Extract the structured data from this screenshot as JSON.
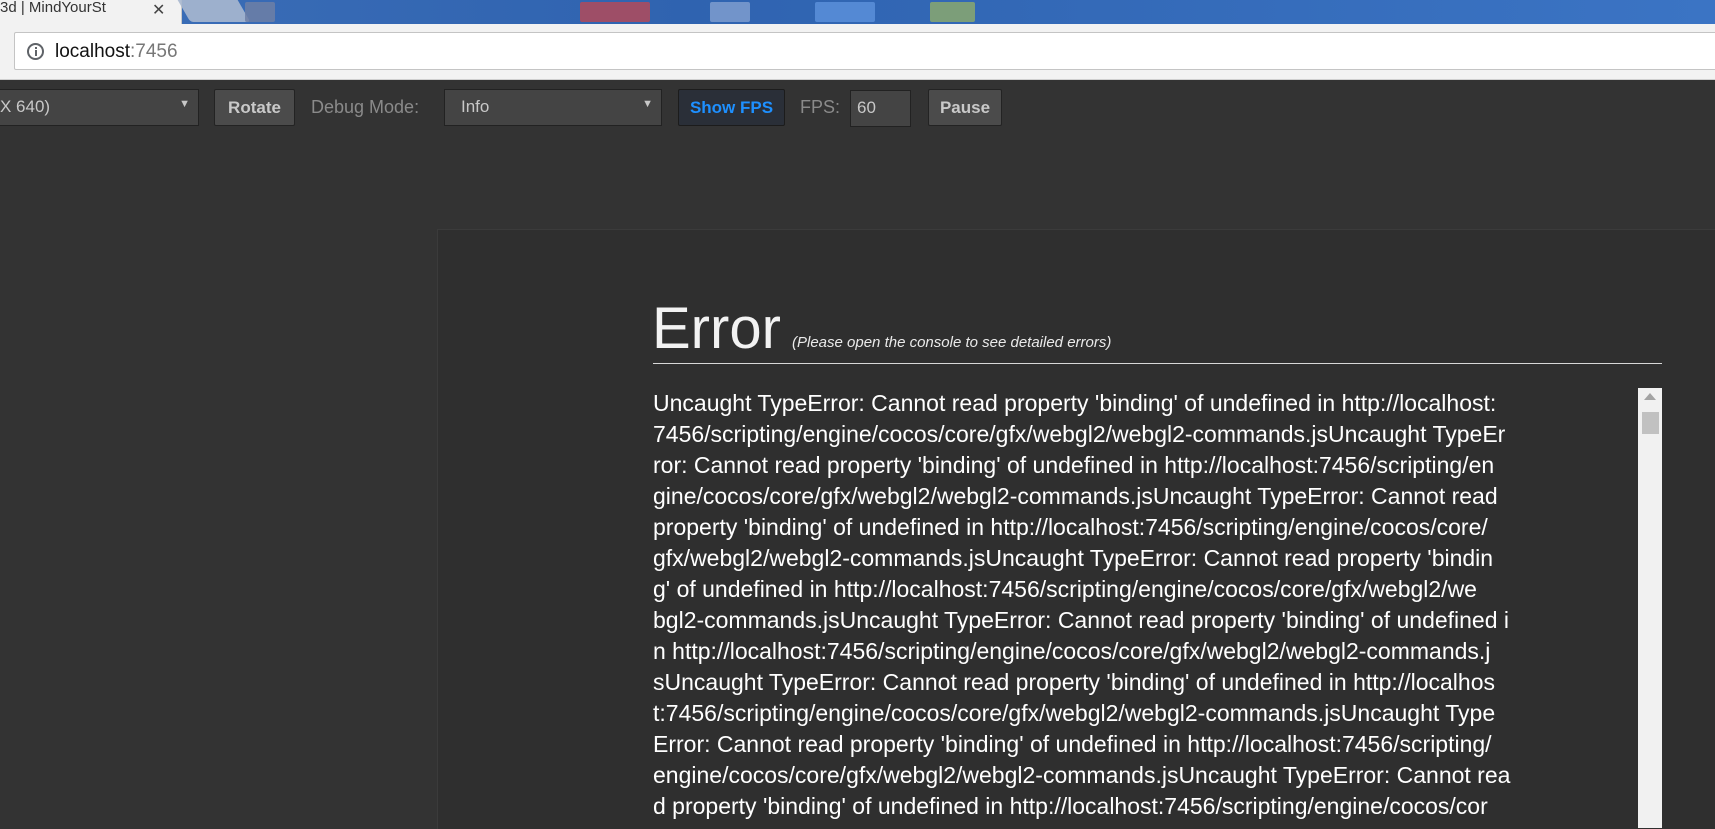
{
  "browser": {
    "tab_title": "3d | MindYourSt",
    "url_host": "localhost",
    "url_port": ":7456"
  },
  "toolbar": {
    "resolution_select": "X 640)",
    "rotate_button": "Rotate",
    "debug_mode_label": "Debug Mode:",
    "debug_mode_select": "Info",
    "show_fps_button": "Show FPS",
    "fps_label": "FPS:",
    "fps_value": "60",
    "pause_button": "Pause"
  },
  "error": {
    "title": "Error",
    "hint": "(Please open the console to see detailed errors)",
    "lines": [
      "Uncaught TypeError: Cannot read property 'binding' of undefined in http://localhost:",
      "7456/scripting/engine/cocos/core/gfx/webgl2/webgl2-commands.jsUncaught TypeEr",
      "ror: Cannot read property 'binding' of undefined in http://localhost:7456/scripting/en",
      "gine/cocos/core/gfx/webgl2/webgl2-commands.jsUncaught TypeError: Cannot read",
      "property 'binding' of undefined in http://localhost:7456/scripting/engine/cocos/core/",
      "gfx/webgl2/webgl2-commands.jsUncaught TypeError: Cannot read property 'bindin",
      "g' of undefined in http://localhost:7456/scripting/engine/cocos/core/gfx/webgl2/we",
      "bgl2-commands.jsUncaught TypeError: Cannot read property 'binding' of undefined i",
      "n http://localhost:7456/scripting/engine/cocos/core/gfx/webgl2/webgl2-commands.j",
      "sUncaught TypeError: Cannot read property 'binding' of undefined in http://localhos",
      "t:7456/scripting/engine/cocos/core/gfx/webgl2/webgl2-commands.jsUncaught Type",
      "Error: Cannot read property 'binding' of undefined in http://localhost:7456/scripting/",
      "engine/cocos/core/gfx/webgl2/webgl2-commands.jsUncaught TypeError: Cannot rea",
      "d property 'binding' of undefined in http://localhost:7456/scripting/engine/cocos/cor"
    ]
  },
  "colors": {
    "background": "#333333",
    "accent": "#1e90ff",
    "error_text": "#ffffff"
  },
  "icons": {
    "address": "info-icon",
    "tab_close": "close-icon",
    "select_caret": "caret-down-icon"
  }
}
